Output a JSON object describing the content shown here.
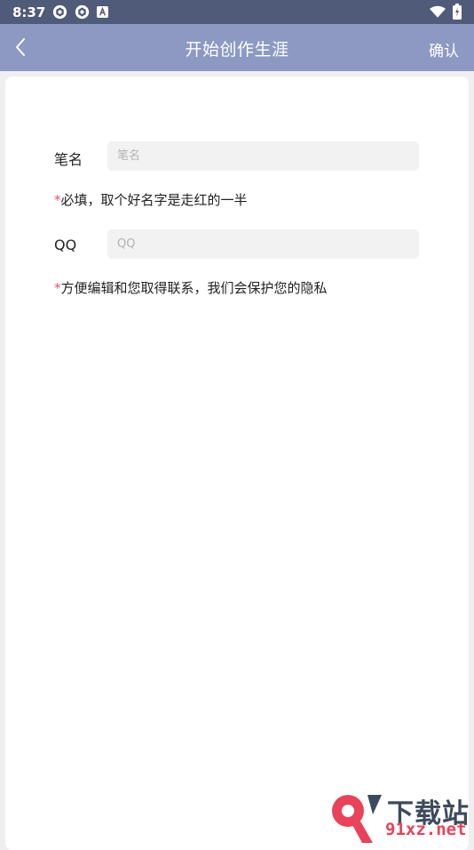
{
  "status_bar": {
    "time": "8:37",
    "left_icons": [
      "aperture-icon",
      "aperture-icon",
      "a-badge-icon"
    ],
    "right_icons": [
      "wifi-icon",
      "battery-charging-icon"
    ]
  },
  "app_bar": {
    "title": "开始创作生涯",
    "confirm_label": "确认",
    "back_icon": "chevron-left-icon"
  },
  "form": {
    "pen_name": {
      "label": "笔名",
      "value": "",
      "placeholder": "笔名"
    },
    "pen_name_hint": {
      "star": "*",
      "text": "必填，取个好名字是走红的一半"
    },
    "qq": {
      "label": "QQ",
      "value": "",
      "placeholder": "QQ"
    },
    "qq_hint": {
      "star": "*",
      "text": "方便编辑和您取得联系，我们会保护您的隐私"
    }
  },
  "watermark": {
    "line1": "下载站",
    "line2": "91xz.net",
    "logo_text": "9"
  },
  "colors": {
    "status_bar": "#505a79",
    "app_bar": "#8d99c2",
    "accent_star": "#e8506d",
    "input_bg": "#f2f2f2"
  }
}
